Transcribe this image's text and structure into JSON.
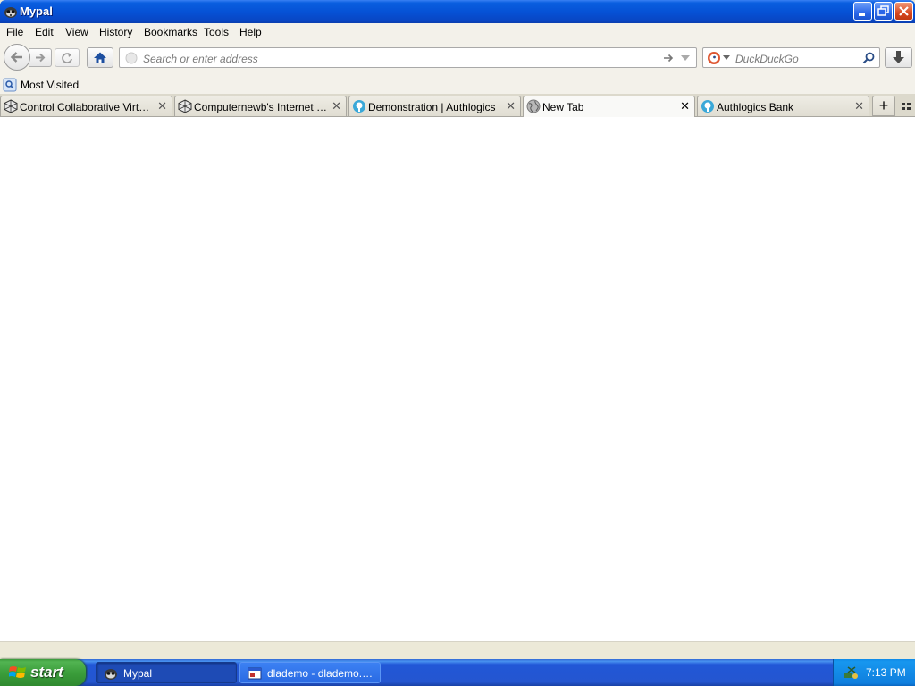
{
  "window": {
    "title": "Mypal"
  },
  "menu": {
    "items": [
      "File",
      "Edit",
      "View",
      "History",
      "Bookmarks",
      "Tools",
      "Help"
    ]
  },
  "navbar": {
    "url_placeholder": "Search or enter address",
    "url_value": "",
    "search_placeholder": "DuckDuckGo",
    "search_engine": "DuckDuckGo"
  },
  "bookmarks": {
    "items": [
      {
        "label": "Most Visited"
      }
    ]
  },
  "tabs": [
    {
      "label": "Control Collaborative Virtual ...",
      "icon": "virtual-desktop-icon",
      "selected": false
    },
    {
      "label": "Computernewb's Internet Pu...",
      "icon": "virtual-desktop-icon",
      "selected": false
    },
    {
      "label": "Demonstration | Authlogics",
      "icon": "authlogics-icon",
      "selected": false
    },
    {
      "label": "New Tab",
      "icon": "globe-icon",
      "selected": true
    },
    {
      "label": "Authlogics Bank",
      "icon": "authlogics-icon",
      "selected": false
    }
  ],
  "taskbar": {
    "start_label": "start",
    "tasks": [
      {
        "label": "Mypal",
        "active": true
      },
      {
        "label": "dlademo - dlademo.a...",
        "active": false
      }
    ],
    "clock": "7:13 PM"
  },
  "colors": {
    "titlebar": "#0652d6",
    "taskbar": "#2456d0",
    "start": "#3b9e3b"
  }
}
